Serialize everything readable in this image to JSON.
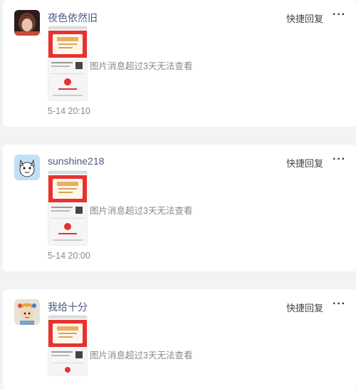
{
  "messages": [
    {
      "nickname": "夜色依然旧",
      "avatar_icon": "user-photo-avatar-icon",
      "quick_reply": "快捷回复",
      "more_icon": "more-options-icon",
      "image_notice": "图片消息超过3天无法查看",
      "time": "5-14 20:10"
    },
    {
      "nickname": "sunshine218",
      "avatar_icon": "cartoon-cat-avatar-icon",
      "quick_reply": "快捷回复",
      "more_icon": "more-options-icon",
      "image_notice": "图片消息超过3天无法查看",
      "time": "5-14 20:00"
    },
    {
      "nickname": "我给十分",
      "avatar_icon": "cartoon-character-avatar-icon",
      "quick_reply": "快捷回复",
      "more_icon": "more-options-icon",
      "image_notice": "图片消息超过3天无法查看",
      "time": ""
    }
  ],
  "more_glyph": "···",
  "colors": {
    "nickname": "#4a5a85",
    "certificate_red": "#e8322f",
    "background": "#f2f3f5"
  }
}
